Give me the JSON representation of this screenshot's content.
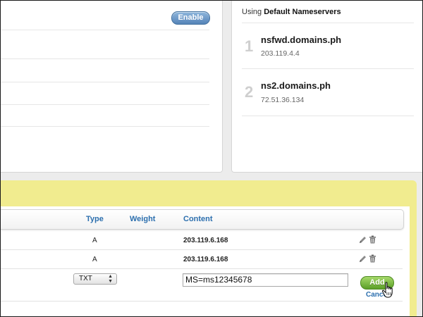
{
  "dnssec": {
    "enable_label": "Enable"
  },
  "nameservers": {
    "heading_prefix": "Using",
    "heading_bold": "Default Nameservers",
    "items": [
      {
        "index": "1",
        "name": "nsfwd.domains.ph",
        "ip": "203.119.4.4"
      },
      {
        "index": "2",
        "name": "ns2.domains.ph",
        "ip": "72.51.36.134"
      }
    ]
  },
  "dns_table": {
    "columns": {
      "type": "Type",
      "weight": "Weight",
      "content": "Content"
    },
    "rows": [
      {
        "type": "A",
        "content": "203.119.6.168"
      },
      {
        "type": "A",
        "content": "203.119.6.168"
      }
    ],
    "new_record": {
      "type_value": "TXT",
      "content_value": "MS=ms12345678",
      "add_label": "Add",
      "cancel_label": "Cancel"
    }
  },
  "icons": [
    "pencil-icon",
    "trash-icon",
    "hand-cursor-icon",
    "select-arrows-icon"
  ],
  "colors": {
    "enable_button": "#5584b8",
    "add_button": "#5b9f27",
    "highlight": "#f1ec8f",
    "link": "#2c6fae"
  }
}
